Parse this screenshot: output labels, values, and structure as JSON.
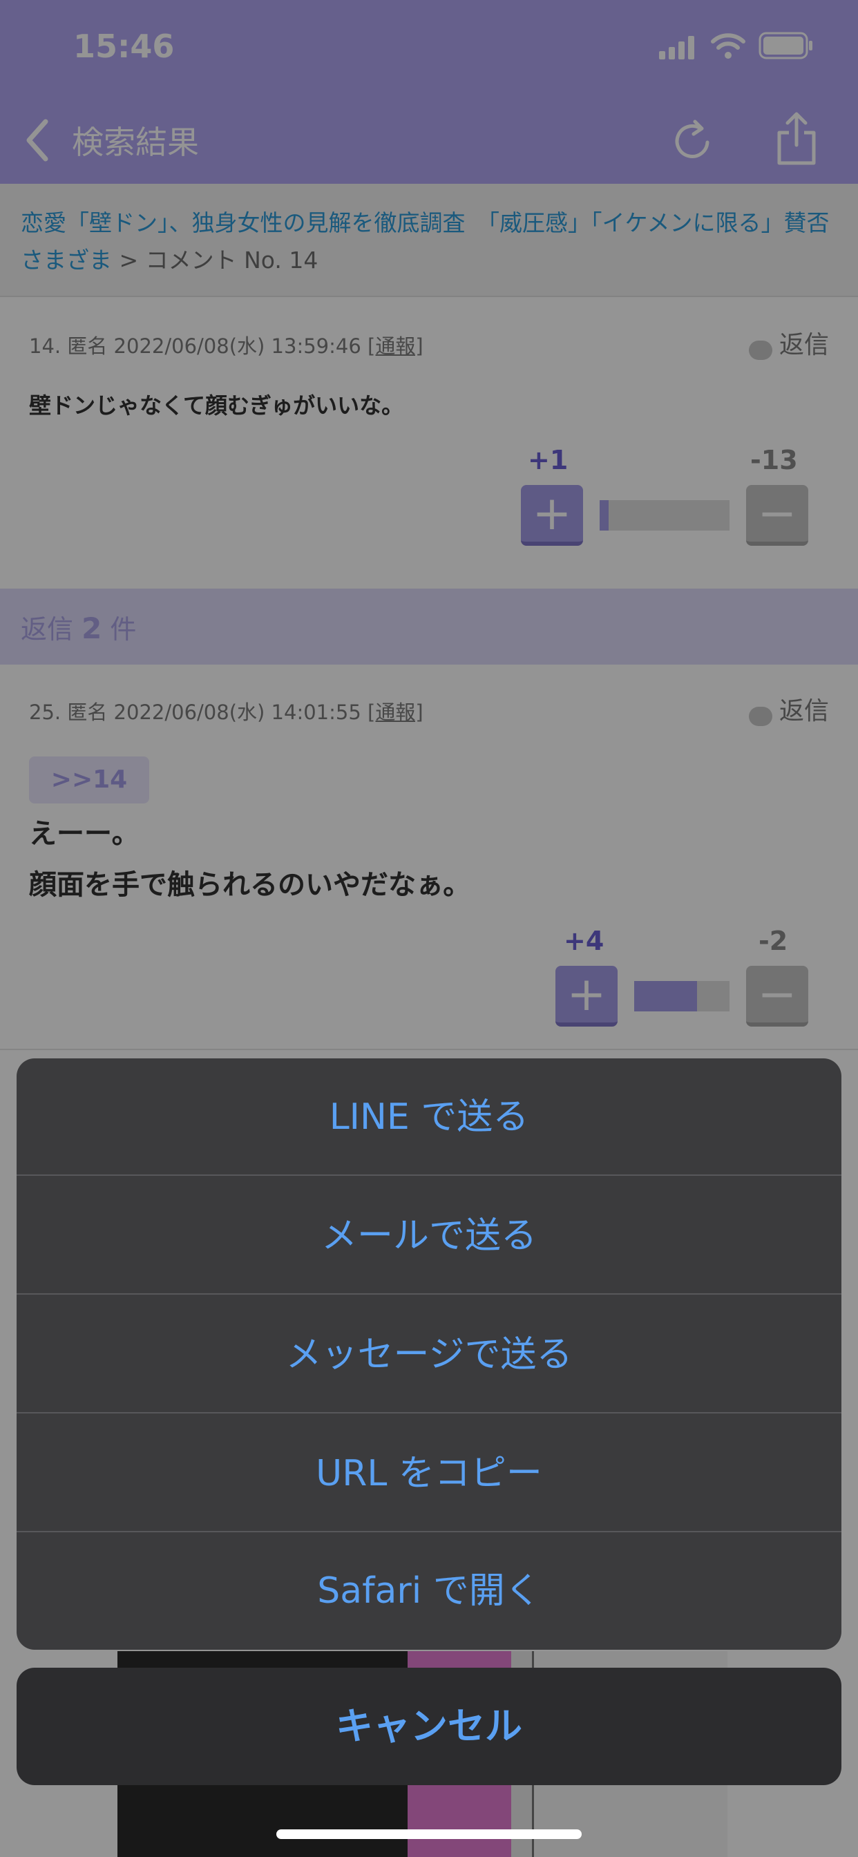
{
  "status_bar": {
    "time": "15:46"
  },
  "nav": {
    "back_label": "検索結果"
  },
  "breadcrumb": {
    "link_text": "恋愛「壁ドン」、独身女性の見解を徹底調査　「威圧感」「イケメンに限る」賛否さまざま",
    "suffix": " > コメント No. 14"
  },
  "comment": {
    "meta": "14. 匿名 2022/06/08(水) 13:59:46",
    "report_label": "[通報]",
    "reply_label": "返信",
    "body": "壁ドンじゃなくて顔むぎゅがいいな。",
    "plus_count": "+1",
    "minus_count": "-13",
    "plus_ratio": 0.07,
    "plus_symbol": "+",
    "minus_symbol": "−"
  },
  "replies_header": {
    "prefix": "返信 ",
    "count": "2",
    "suffix": " 件"
  },
  "reply": {
    "meta": "25. 匿名 2022/06/08(水) 14:01:55",
    "report_label": "[通報]",
    "reply_label": "返信",
    "anchor": ">>14",
    "body_line1": "えーー。",
    "body_line2": "顔面を手で触られるのいやだなぁ。",
    "plus_count": "+4",
    "minus_count": "-2",
    "plus_ratio": 0.66,
    "plus_symbol": "+",
    "minus_symbol": "−"
  },
  "action_sheet": {
    "items": [
      "LINE で送る",
      "メールで送る",
      "メッセージで送る",
      "URL をコピー",
      "Safari で開く"
    ],
    "cancel": "キャンセル"
  },
  "colors": {
    "nav_purple": "#b0a6f2",
    "link_blue": "#2e9ad8",
    "vote_plus": "#6a5fd3",
    "vote_minus": "#8a8a8a",
    "sheet_text": "#5aa0f2"
  }
}
